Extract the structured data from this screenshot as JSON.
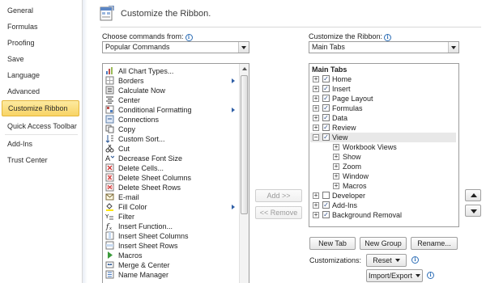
{
  "nav": {
    "items": [
      {
        "label": "General"
      },
      {
        "label": "Formulas"
      },
      {
        "label": "Proofing"
      },
      {
        "label": "Save"
      },
      {
        "label": "Language"
      },
      {
        "label": "Advanced"
      },
      {
        "label": "Customize Ribbon",
        "active": true
      },
      {
        "label": "Quick Access Toolbar"
      },
      {
        "label": "Add-Ins"
      },
      {
        "label": "Trust Center"
      }
    ]
  },
  "header": {
    "title": "Customize the Ribbon."
  },
  "left": {
    "choose_label": "Choose commands from:",
    "choose_value": "Popular Commands",
    "commands": [
      {
        "label": "All Chart Types...",
        "icon": "chart-icon"
      },
      {
        "label": "Borders",
        "icon": "borders-icon",
        "submenu": true
      },
      {
        "label": "Calculate Now",
        "icon": "calculate-icon"
      },
      {
        "label": "Center",
        "icon": "center-icon"
      },
      {
        "label": "Conditional Formatting",
        "icon": "conditional-formatting-icon",
        "submenu": true
      },
      {
        "label": "Connections",
        "icon": "connections-icon"
      },
      {
        "label": "Copy",
        "icon": "copy-icon"
      },
      {
        "label": "Custom Sort...",
        "icon": "sort-icon"
      },
      {
        "label": "Cut",
        "icon": "cut-icon"
      },
      {
        "label": "Decrease Font Size",
        "icon": "decrease-font-icon"
      },
      {
        "label": "Delete Cells...",
        "icon": "delete-cells-icon"
      },
      {
        "label": "Delete Sheet Columns",
        "icon": "delete-columns-icon"
      },
      {
        "label": "Delete Sheet Rows",
        "icon": "delete-rows-icon"
      },
      {
        "label": "E-mail",
        "icon": "email-icon"
      },
      {
        "label": "Fill Color",
        "icon": "fill-color-icon",
        "submenu": true
      },
      {
        "label": "Filter",
        "icon": "filter-icon"
      },
      {
        "label": "Insert Function...",
        "icon": "function-icon"
      },
      {
        "label": "Insert Sheet Columns",
        "icon": "insert-columns-icon"
      },
      {
        "label": "Insert Sheet Rows",
        "icon": "insert-rows-icon"
      },
      {
        "label": "Macros",
        "icon": "macros-icon"
      },
      {
        "label": "Merge & Center",
        "icon": "merge-center-icon"
      },
      {
        "label": "Name Manager",
        "icon": "name-manager-icon"
      }
    ]
  },
  "middle": {
    "add_label": "Add >>",
    "remove_label": "<< Remove"
  },
  "right": {
    "customize_label": "Customize the Ribbon:",
    "customize_value": "Main Tabs",
    "tree_header": "Main Tabs",
    "tree": [
      {
        "label": "Home",
        "level": 0,
        "expander": "+",
        "checked": true
      },
      {
        "label": "Insert",
        "level": 0,
        "expander": "+",
        "checked": true
      },
      {
        "label": "Page Layout",
        "level": 0,
        "expander": "+",
        "checked": true
      },
      {
        "label": "Formulas",
        "level": 0,
        "expander": "+",
        "checked": true
      },
      {
        "label": "Data",
        "level": 0,
        "expander": "+",
        "checked": true
      },
      {
        "label": "Review",
        "level": 0,
        "expander": "+",
        "checked": true
      },
      {
        "label": "View",
        "level": 0,
        "expander": "−",
        "checked": true,
        "selected": true
      },
      {
        "label": "Workbook Views",
        "level": 1,
        "expander": "+"
      },
      {
        "label": "Show",
        "level": 1,
        "expander": "+"
      },
      {
        "label": "Zoom",
        "level": 1,
        "expander": "+"
      },
      {
        "label": "Window",
        "level": 1,
        "expander": "+"
      },
      {
        "label": "Macros",
        "level": 1,
        "expander": "+"
      },
      {
        "label": "Developer",
        "level": 0,
        "expander": "+",
        "checked": false
      },
      {
        "label": "Add-Ins",
        "level": 0,
        "expander": "+",
        "checked": true
      },
      {
        "label": "Background Removal",
        "level": 0,
        "expander": "+",
        "checked": true
      }
    ],
    "new_tab_label": "New Tab",
    "new_group_label": "New Group",
    "rename_label": "Rename...",
    "customizations_label": "Customizations:",
    "reset_label": "Reset",
    "import_export_label": "Import/Export"
  },
  "colors": {
    "accent_nav": "#f8d465",
    "info": "#2f6fb7",
    "selection": "#e8e8e8"
  }
}
